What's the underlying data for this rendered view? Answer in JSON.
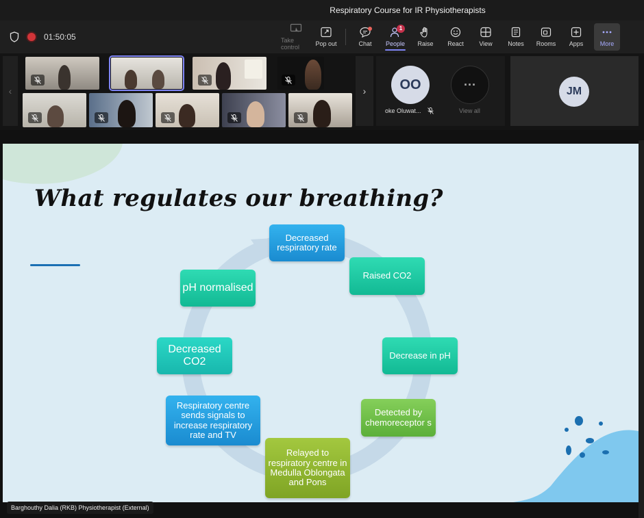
{
  "window": {
    "title": "Respiratory Course for IR Physiotherapists"
  },
  "meeting": {
    "timer": "01:50:05"
  },
  "toolbar": {
    "items": [
      {
        "label": "Take control",
        "icon": "take-control-icon",
        "enabled": false
      },
      {
        "label": "Pop out",
        "icon": "pop-out-icon",
        "enabled": true
      },
      {
        "label": "Chat",
        "icon": "chat-icon",
        "enabled": true
      },
      {
        "label": "People",
        "icon": "people-icon",
        "badge": "1",
        "active": true
      },
      {
        "label": "Raise",
        "icon": "raise-hand-icon",
        "enabled": true
      },
      {
        "label": "React",
        "icon": "react-icon",
        "enabled": true
      },
      {
        "label": "View",
        "icon": "view-icon",
        "enabled": true
      },
      {
        "label": "Notes",
        "icon": "notes-icon",
        "enabled": true
      },
      {
        "label": "Rooms",
        "icon": "rooms-icon",
        "enabled": true
      },
      {
        "label": "Apps",
        "icon": "apps-icon",
        "enabled": true
      },
      {
        "label": "More",
        "icon": "more-icon",
        "enabled": true
      }
    ]
  },
  "participants": {
    "oo_initials": "OO",
    "oo_name": "oke Oluwat...",
    "view_all": "View all",
    "view_all_glyph": "···",
    "jm_initials": "JM"
  },
  "slide": {
    "title": "What regulates our breathing?",
    "cycle": {
      "decreased_rr": "Decreased respiratory rate",
      "raised_co2": "Raised CO2",
      "decrease_ph": "Decrease in pH",
      "detected": "Detected by chemoreceptor s",
      "relayed": "Relayed to respiratory centre in Medulla Oblongata and Pons",
      "resp_centre": "Respiratory centre sends signals to increase respiratory rate and TV",
      "decreased_co2": "Decreased CO2",
      "ph_normalised": "pH normalised"
    }
  },
  "presenter": {
    "caption": "Barghouthy Dalia (RKB) Physiotherapist (External)"
  },
  "colors": {
    "accent": "#7f85f5",
    "record": "#d13438",
    "badge": "#c4314b",
    "slide_bg": "#dcecf4"
  }
}
